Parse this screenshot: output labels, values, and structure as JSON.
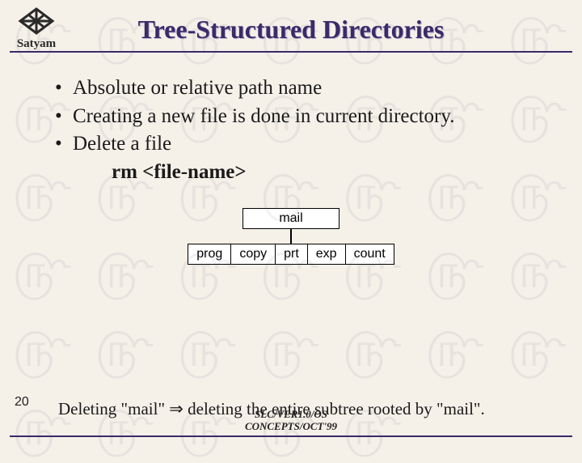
{
  "logo_text": "Satyam",
  "title": "Tree-Structured Directories",
  "bullets": [
    "Absolute or relative path name",
    "Creating a new file is done in current directory.",
    "Delete a file"
  ],
  "sub_command": "rm <file-name>",
  "diagram": {
    "root": "mail",
    "children": [
      "prog",
      "copy",
      "prt",
      "exp",
      "count"
    ]
  },
  "footer_sentence_a": "Deleting \"mail\" ",
  "footer_arrow": "⇒",
  "footer_sentence_b": " deleting the entire subtree rooted by \"mail\".",
  "page_number": "20",
  "meta_line1": "SLC/VER1.0/OS",
  "meta_line2": "CONCEPTS/OCT'99"
}
